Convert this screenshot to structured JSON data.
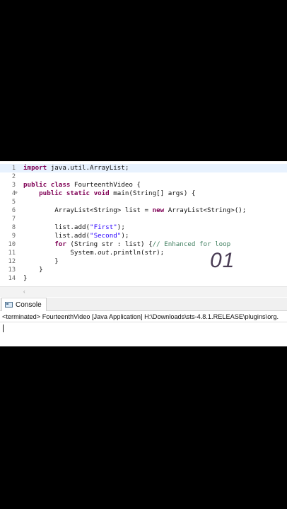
{
  "editor": {
    "lines": [
      {
        "num": "1",
        "parts": [
          {
            "t": "import",
            "c": "kw"
          },
          {
            "t": " java.util.ArrayList;",
            "c": ""
          }
        ]
      },
      {
        "num": "2",
        "parts": []
      },
      {
        "num": "3",
        "parts": [
          {
            "t": "public class",
            "c": "kw"
          },
          {
            "t": " FourteenthVideo {",
            "c": ""
          }
        ]
      },
      {
        "num": "4",
        "parts": [
          {
            "t": "    ",
            "c": ""
          },
          {
            "t": "public static void",
            "c": "kw"
          },
          {
            "t": " main(String[] args) {",
            "c": ""
          }
        ]
      },
      {
        "num": "5",
        "parts": []
      },
      {
        "num": "6",
        "parts": [
          {
            "t": "        ArrayList<String> list = ",
            "c": ""
          },
          {
            "t": "new",
            "c": "kw"
          },
          {
            "t": " ArrayList<String>();",
            "c": ""
          }
        ]
      },
      {
        "num": "7",
        "parts": []
      },
      {
        "num": "8",
        "parts": [
          {
            "t": "        list.add(",
            "c": ""
          },
          {
            "t": "\"First\"",
            "c": "str"
          },
          {
            "t": ");",
            "c": ""
          }
        ]
      },
      {
        "num": "9",
        "parts": [
          {
            "t": "        list.add(",
            "c": ""
          },
          {
            "t": "\"Second\"",
            "c": "str"
          },
          {
            "t": ");",
            "c": ""
          }
        ]
      },
      {
        "num": "10",
        "parts": [
          {
            "t": "        ",
            "c": ""
          },
          {
            "t": "for",
            "c": "kw"
          },
          {
            "t": " (String str : list) {",
            "c": ""
          },
          {
            "t": "// Enhanced for loop",
            "c": "cmt"
          }
        ]
      },
      {
        "num": "11",
        "parts": [
          {
            "t": "            System.",
            "c": ""
          },
          {
            "t": "out",
            "c": "it"
          },
          {
            "t": ".println(str);",
            "c": ""
          }
        ]
      },
      {
        "num": "12",
        "parts": [
          {
            "t": "        }",
            "c": ""
          }
        ]
      },
      {
        "num": "13",
        "parts": [
          {
            "t": "    }",
            "c": ""
          }
        ]
      },
      {
        "num": "14",
        "parts": [
          {
            "t": "}",
            "c": ""
          }
        ]
      }
    ],
    "active_line": "1",
    "fold_markers": [
      "4"
    ]
  },
  "overlay_number": "01",
  "console": {
    "tab_label": "Console",
    "terminated_text": "<terminated> FourteenthVideo [Java Application] H:\\Downloads\\sts-4.8.1.RELEASE\\plugins\\org.",
    "icon": "console-icon"
  },
  "scrollbar": {
    "left_arrow": "‹"
  }
}
